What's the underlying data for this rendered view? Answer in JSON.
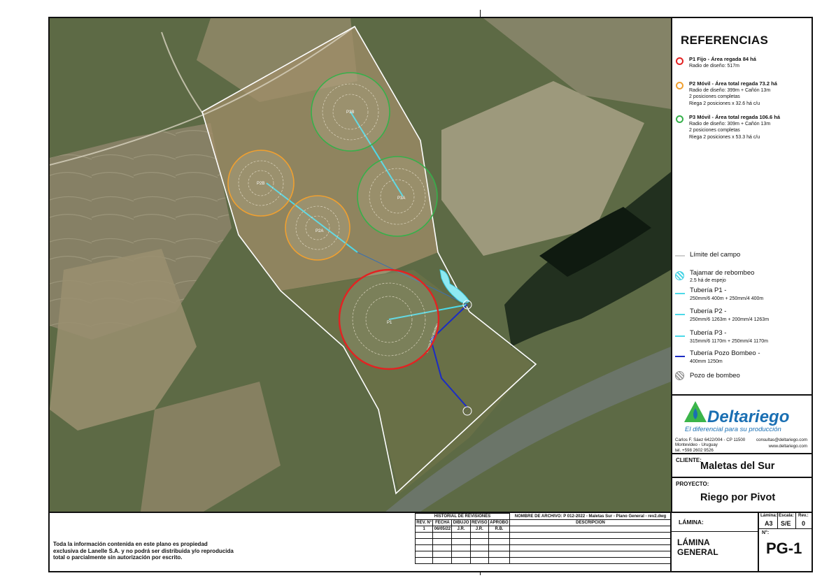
{
  "sidebar": {
    "title": "REFERENCIAS",
    "refs": [
      {
        "name": "P1  Fijo - Área regada 84 há",
        "lines": [
          "Radio de diseño: 517m"
        ],
        "color": "#e32222"
      },
      {
        "name": "P2  Móvil - Área total regada 73.2 há",
        "lines": [
          "Radio de diseño: 399m + Cañón 13m",
          "2 posiciones completas",
          "Riega 2 posiciones x 32.6 há c/u"
        ],
        "color": "#f0a030"
      },
      {
        "name": "P3  Móvil - Área total regada 106.6 há",
        "lines": [
          "Radio de diseño: 309m + Cañón 13m",
          "2 posiciones completas",
          "Riega 2 posiciones x 53.3 há c/u"
        ],
        "color": "#36b04a"
      }
    ],
    "legend": {
      "limite": "Límite del campo",
      "tajamar": "Tajamar de rebombeo",
      "tajamar_sub": "2.5 há de espejo",
      "p1": "Tubería P1 -",
      "p1_sub": "250mm/6 400m + 250mm/4 400m",
      "p2": "Tubería P2 -",
      "p2_sub": "250mm/6 1263m + 200mm/4 1263m",
      "p3": "Tubería P3 -",
      "p3_sub": "315mm/6 1170m + 250mm/4 1170m",
      "pozo_tub": "Tubería Pozo Bombeo -",
      "pozo_tub_sub": "400mm 1250m",
      "pozo": "Pozo de bombeo"
    },
    "logo": {
      "name": "Deltariego",
      "tagline": "El diferencial para su producción",
      "address1": "Carlos F. Sáez 6422/004 - CP 11500",
      "address2": "Montevideo - Uruguay",
      "address3": "tel. +598 2602 9526",
      "email": "consultas@deltariego.com",
      "web": "www.deltariego.com"
    },
    "cliente_label": "CLIENTE:",
    "cliente": "Maletas del Sur",
    "proyecto_label": "PROYECTO:",
    "proyecto": "Riego por Pivot"
  },
  "map_labels": {
    "p1": "P1",
    "p2a": "P2A",
    "p2b": "P2B",
    "p3a": "P3A",
    "p3b": "P3B",
    "pozo_line": "Tubería Pozo Bombeo"
  },
  "bottom": {
    "disclaimer": [
      "Toda la información contenida en este plano es propiedad",
      "exclusiva de Lanelle S.A. y no podrá ser distribuida y/o reproducida",
      "total o parcialmente sin autorización por escrito."
    ],
    "historial": "HISTORIAL DE REVISIONES",
    "archivo_label": "NOMBRE DE ARCHIVO:",
    "archivo": "P 012-2022 - Maletas Sur - Plano General - rev2.dwg",
    "headers": [
      "REV. N°",
      "FECHA",
      "DIBUJÓ",
      "REVISÓ",
      "APROBÓ"
    ],
    "descripcion": "DESCRIPCIÓN",
    "row": [
      "1",
      "06/05/22",
      "J.R.",
      "J.R.",
      "R.B."
    ],
    "lamina_label": "LÁMINA:",
    "lamina_size_label": "Lámina:",
    "lamina_size": "A3",
    "escala_label": "Escala:",
    "escala": "S/E",
    "rev_label": "Rev.:",
    "rev": "0",
    "lamina_general": "LÁMINA GENERAL",
    "num_label": "N°:",
    "num": "PG-1"
  }
}
